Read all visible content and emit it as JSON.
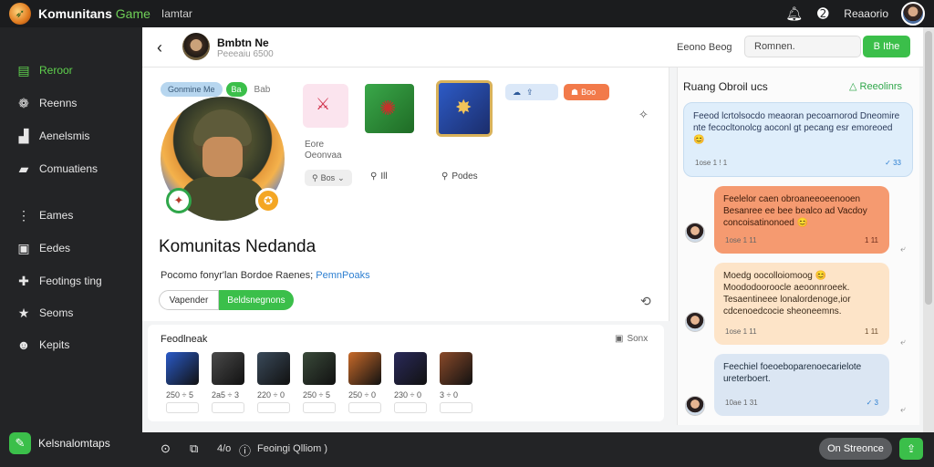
{
  "app": {
    "title": "Komunitans",
    "title_accent": "Game",
    "subtitle": "Iamtar"
  },
  "topbar": {
    "user_name": "Reaaorio"
  },
  "sidebar": {
    "items": [
      {
        "label": "Reroor",
        "icon": "chart-icon",
        "active": true
      },
      {
        "label": "Reenns",
        "icon": "people-icon"
      },
      {
        "label": "Aenelsmis",
        "icon": "message-icon"
      },
      {
        "label": "Comuatiens",
        "icon": "feed-icon"
      },
      {
        "label": "Eames",
        "icon": "games-icon"
      },
      {
        "label": "Eedes",
        "icon": "files-icon"
      },
      {
        "label": "Feotings ting",
        "icon": "puzzle-icon"
      },
      {
        "label": "Seoms",
        "icon": "star-icon"
      },
      {
        "label": "Kepits",
        "icon": "avatar-icon"
      }
    ],
    "bottom": {
      "label": "Kelsnalomtaps"
    }
  },
  "header": {
    "name": "Bmbtn Ne",
    "sub": "Peeeaiu 6500",
    "sort_label": "Eeono Beog",
    "search_placeholder": "Romnen.",
    "button_label": "B Ithe"
  },
  "profile": {
    "chip_label": "Gonmine Me",
    "chip_badge": "Ba",
    "chip_extra": "Bab",
    "title": "Komunitas Nedanda",
    "description": "Pocomo fonyr'lan Bordoe Raenes;",
    "description_link": "PemnPoaks",
    "segment_a": "Vapender",
    "segment_b": "Beldsnegnons",
    "tiles": [
      {
        "caption": "Eore Oeonvaa",
        "meta": "Bos"
      },
      {
        "caption": "",
        "meta": "Ill"
      },
      {
        "caption": "",
        "meta": "Podes"
      }
    ],
    "pill_blue": "",
    "pill_orange": "Boo"
  },
  "favorites": {
    "title": "Feodlneak",
    "status": "Sonx",
    "items": [
      {
        "val": "250 ÷ 5",
        "color": "#2a5ac8"
      },
      {
        "val": "2a5 ÷ 3",
        "color": "#4a4a4a"
      },
      {
        "val": "220 ÷ 0",
        "color": "#3a4a5a"
      },
      {
        "val": "250 ÷ 5",
        "color": "#3a4a3a"
      },
      {
        "val": "250 ÷ 0",
        "color": "#c86a2a"
      },
      {
        "val": "230 ÷ 0",
        "color": "#2a2a5a"
      },
      {
        "val": "3 ÷ 0",
        "color": "#8a4a2a"
      }
    ]
  },
  "chat": {
    "title": "Ruang Obroil ucs",
    "action": "Reeolinrs",
    "messages": [
      {
        "text": "Feeod lcrtolsocdo meaoran pecoarnorod Dneomire nte fecocltonolcg aoconl gt pecang esr emoreoed 😊",
        "time": "1ose 1 ! 1",
        "read": "✓ 33",
        "style": "blue"
      },
      {
        "text": "Feelelor caen obroaneeoeenooen Besanree ee bee bealco ad Vacdoy concoisatinonoed 😊",
        "time": "1ose 1 11",
        "read": "1 11",
        "style": "orange"
      },
      {
        "text": "Moedg oocolloiomoog 😊 Moododooroocle aeoonnroeek. Tesaentineee lonalordenoge,ior cdcenoedcocie sheoneemns.",
        "time": "1ose 1 11",
        "read": "1 11",
        "style": "cream"
      },
      {
        "text": "Feechiel foeoeboparenoecarielote ureterboert.",
        "time": "10ae 1 31",
        "read": "✓ 3",
        "style": "lightblue"
      }
    ]
  },
  "bottombar": {
    "count": "4/o",
    "text": "Feoingi Qlliom )",
    "button": "On Streonce"
  }
}
